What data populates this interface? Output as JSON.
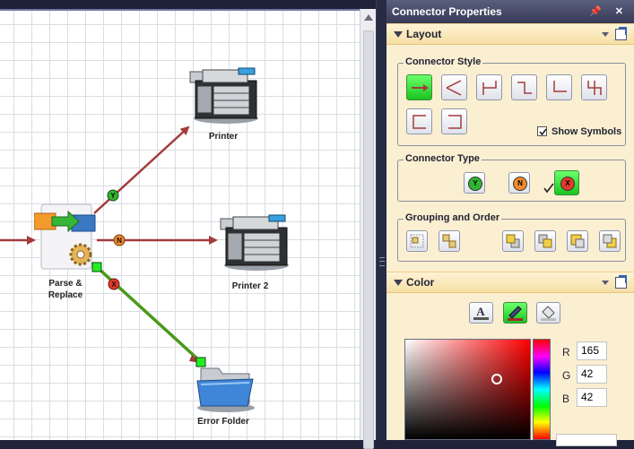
{
  "colors": {
    "accent_green": "#22cc22",
    "connector_red": "#a43c3c",
    "connector_green": "#4a9a1a",
    "panel_bg": "#fbefd1",
    "titlebar": "#454a69"
  },
  "canvas": {
    "nodes": [
      {
        "id": "parse-replace",
        "label_line1": "Parse &",
        "label_line2": "Replace"
      },
      {
        "id": "printer",
        "label": "Printer"
      },
      {
        "id": "printer-2",
        "label": "Printer 2"
      },
      {
        "id": "error-folder",
        "label": "Error Folder"
      }
    ],
    "connectors": [
      {
        "from": "parse-replace",
        "to": "printer",
        "symbol": "Y",
        "color": "red"
      },
      {
        "from": "parse-replace",
        "to": "printer-2",
        "symbol": "N",
        "color": "red"
      },
      {
        "from": "parse-replace",
        "to": "error-folder",
        "symbol": "X",
        "color": "green",
        "selected": true
      }
    ]
  },
  "panel": {
    "title": "Connector Properties",
    "title_icons": "📌 ✕",
    "layout_section": {
      "title": "Layout",
      "connector_style": {
        "label": "Connector Style",
        "selected_index": 0,
        "styles": [
          "straight",
          "fan",
          "orthogonal-up",
          "orthogonal-step",
          "orthogonal-corner",
          "orthogonal-split",
          "loop-left",
          "loop-right"
        ],
        "show_symbols_label": "Show Symbols",
        "show_symbols_checked": true
      },
      "connector_type": {
        "label": "Connector Type",
        "types": [
          {
            "symbol": "Y",
            "color": "#2fb52f"
          },
          {
            "symbol": "N",
            "color": "#f08a2a"
          },
          {
            "symbol": "X",
            "color": "#e03a2a",
            "selected": true
          }
        ]
      },
      "grouping": {
        "label": "Grouping and Order",
        "buttons": [
          "group",
          "ungroup",
          "bring-to-front",
          "bring-forward",
          "send-backward",
          "send-to-back"
        ]
      }
    },
    "color_section": {
      "title": "Color",
      "buttons": [
        "text-color",
        "line-color",
        "fill-color"
      ],
      "selected_button": "line-color",
      "r_label": "R",
      "r_value": "165",
      "g_label": "G",
      "g_value": "42",
      "b_label": "B",
      "b_value": "42"
    }
  }
}
